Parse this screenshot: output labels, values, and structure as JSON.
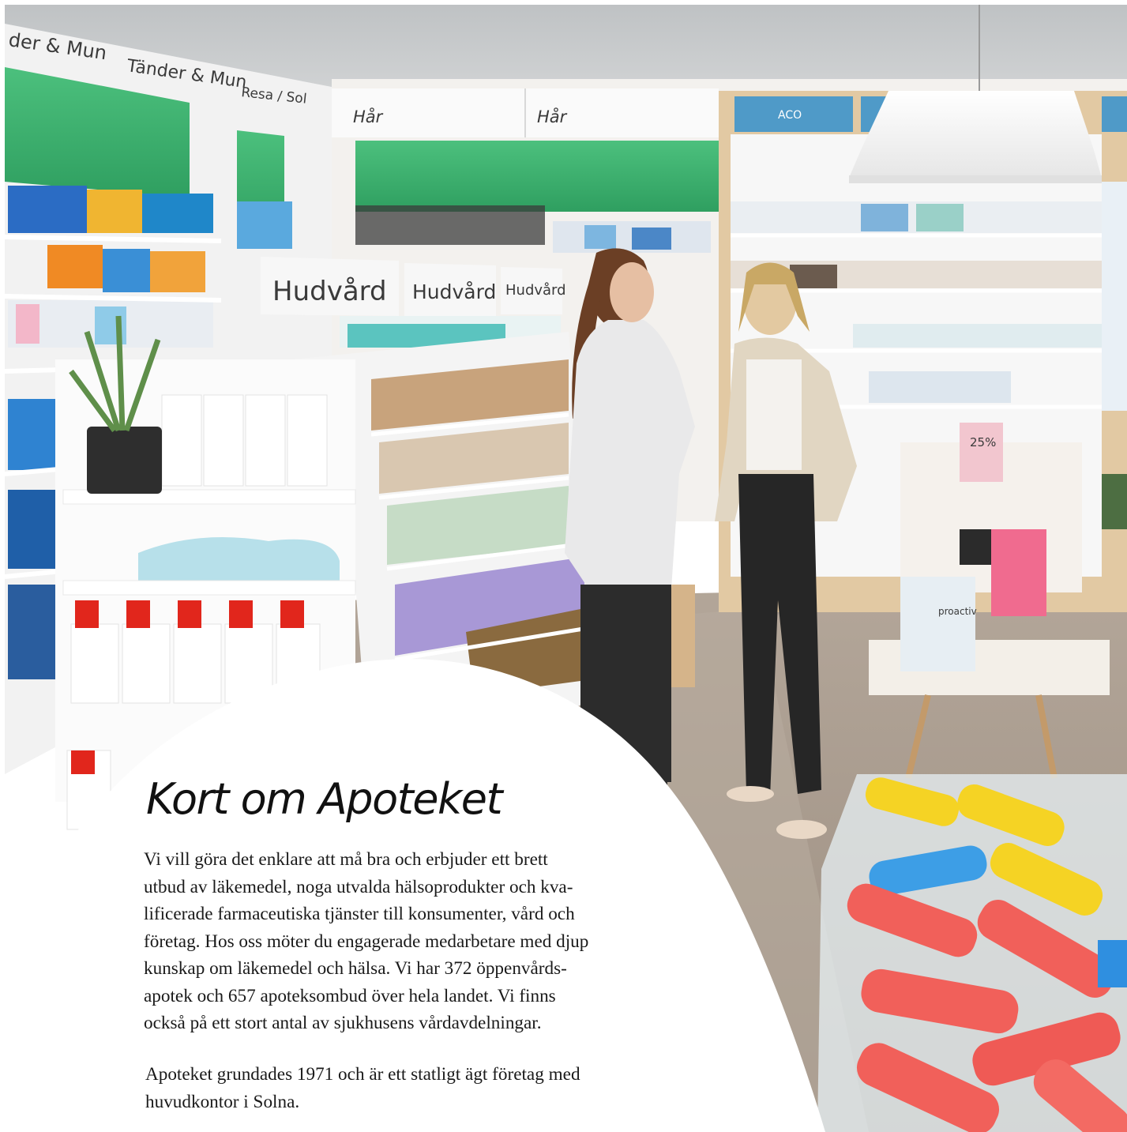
{
  "photo": {
    "signs": {
      "tander_mun_partial": "der & Mun",
      "tander_mun": "Tänder & Mun",
      "resa_sol": "Resa / Sol",
      "har_1": "Hår",
      "har_2": "Hår",
      "aco": "ACO",
      "hudvard_1": "Hudvård",
      "hudvard_2": "Hudvård",
      "hudvard_3": "Hudvård",
      "discount": "25%",
      "proactiv": "proactiv"
    }
  },
  "colors": {
    "shelf_green": "#3fb26f",
    "wall_gray": "#c9ccce",
    "floor": "#a69889",
    "text": "#111111",
    "white": "#ffffff"
  },
  "card": {
    "title": "Kort om Apoteket",
    "paragraph1_lines": [
      "Vi vill göra det enklare att må bra och erbjuder ett brett",
      "utbud av läkemedel, noga utvalda hälsoprodukter och kva-",
      "lificerade farmaceutiska tjänster till konsumenter, vård och",
      "företag. Hos oss möter du engagerade medarbetare med djup",
      "kunskap om läkemedel och hälsa. Vi har 372 öppenvårds-",
      "apotek och 657 apoteksombud över hela landet. Vi finns",
      "också på ett stort antal av sjukhusens vårdavdelningar."
    ],
    "paragraph2_lines": [
      "Apoteket grundades 1971 och är ett statligt ägt företag med",
      "huvudkontor i Solna."
    ]
  }
}
